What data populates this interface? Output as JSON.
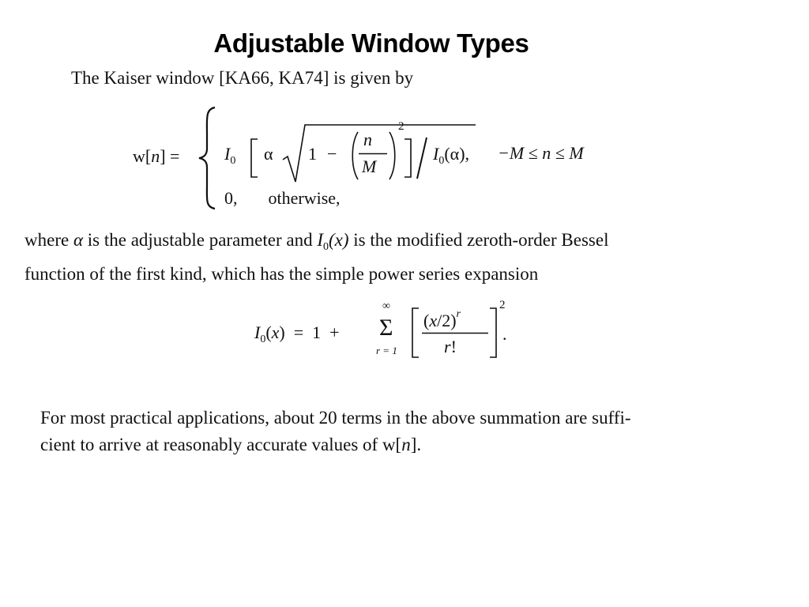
{
  "slide": {
    "title": "Adjustable Window Types",
    "intro": "The Kaiser window [KA66, KA74] is given by",
    "kaiser_equation": {
      "lhs": "w[n] =",
      "case1_expr": "I0 [ α √(1 − (n/M)²) ] / I0(α),",
      "case1_condition": "−M ≤ n ≤ M",
      "case2_value": "0,",
      "case2_condition": "otherwise,",
      "symbols": {
        "w": "w",
        "n": "n",
        "M": "M",
        "I": "I",
        "zero": "0",
        "alpha": "α",
        "one": "1",
        "minus": "−",
        "two": "2",
        "equals": "=",
        "leq": "≤",
        "comma": ","
      }
    },
    "paragraph1": {
      "part1": "where ",
      "alpha": "α",
      "part2": " is the adjustable parameter and ",
      "I0": "I",
      "sub0": "0",
      "x": "(x)",
      "part3": " is the modified zeroth-order Bessel",
      "line2": "function of the first kind, which has the simple power series expansion"
    },
    "bessel_equation": {
      "lhs": "I0(x) = 1 +",
      "sum_upper": "∞",
      "sum_lower": "r = 1",
      "sum_symbol": "Σ",
      "numerator": "(x/2)",
      "numerator_exp": "r",
      "denominator": "r!",
      "outer_exp": "2",
      "period": "."
    },
    "paragraph2": {
      "line1": "For most practical applications, about 20 terms in the above summation are suffi-",
      "line2_part1": "cient to arrive at reasonably accurate values of w[",
      "line2_n": "n",
      "line2_part2": "]."
    }
  }
}
